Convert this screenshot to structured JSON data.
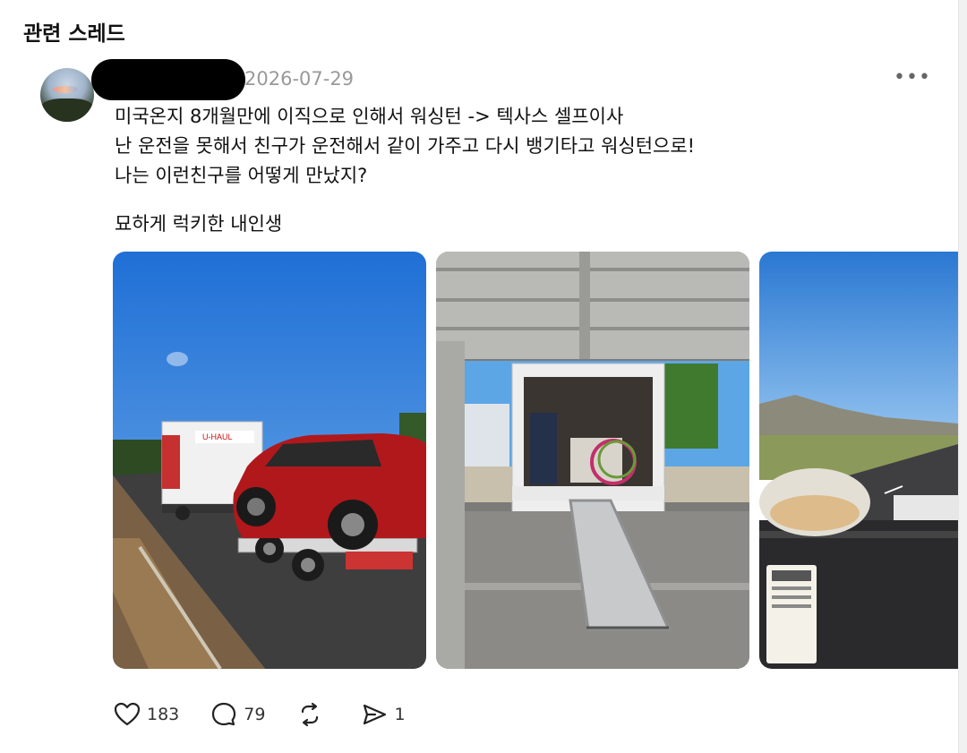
{
  "section": {
    "title": "관련 스레드"
  },
  "post": {
    "date": "2026-07-29",
    "lines": [
      "미국온지 8개월만에 이직으로 인해서 워싱턴 -> 텍사스 셀프이사",
      "난 운전을 못해서 친구가 운전해서 같이 가주고 다시 뱅기타고 워싱턴으로!",
      "나는 이런친구를 어떻게 만났지?"
    ],
    "extra": "묘하게 럭키한 내인생",
    "more_label": "•••"
  },
  "photos": {
    "truck_sign": "U-HAUL"
  },
  "actions": {
    "likes": "183",
    "comments": "79",
    "reposts": "",
    "shares": "1"
  },
  "colors": {
    "text": "#111111",
    "muted": "#999999",
    "sky": "#2f7fd8"
  },
  "icons": [
    "heart-icon",
    "comment-icon",
    "repost-icon",
    "share-icon",
    "more-icon"
  ]
}
